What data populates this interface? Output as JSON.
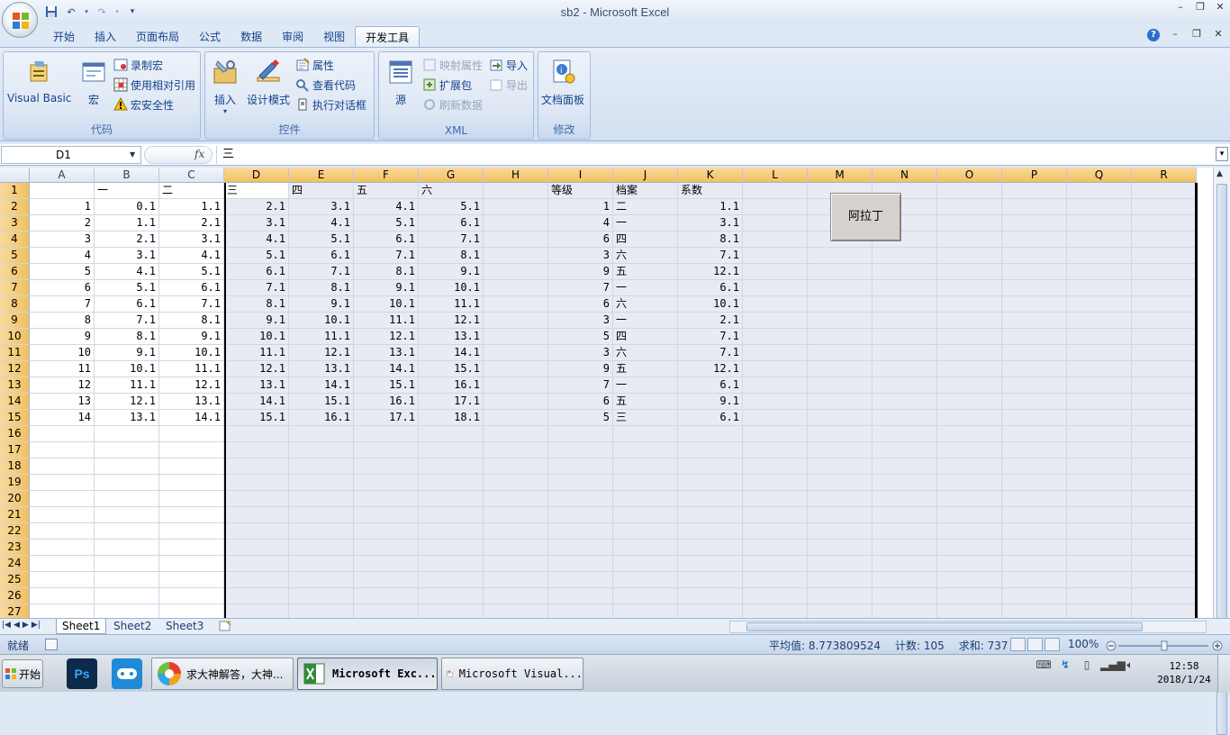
{
  "window": {
    "title": "sb2 - Microsoft Excel"
  },
  "tabs": [
    {
      "label": "开始"
    },
    {
      "label": "插入"
    },
    {
      "label": "页面布局"
    },
    {
      "label": "公式"
    },
    {
      "label": "数据"
    },
    {
      "label": "审阅"
    },
    {
      "label": "视图"
    },
    {
      "label": "开发工具",
      "active": true
    }
  ],
  "ribbon": {
    "code": {
      "label": "代码",
      "visual_basic": "Visual Basic",
      "macros": "宏",
      "record_macro": "录制宏",
      "relative_ref": "使用相对引用",
      "macro_security": "宏安全性"
    },
    "controls": {
      "label": "控件",
      "insert": "插入",
      "design_mode": "设计模式",
      "properties": "属性",
      "view_code": "查看代码",
      "run_dialog": "执行对话框"
    },
    "xml": {
      "label": "XML",
      "source": "源",
      "map_properties": "映射属性",
      "expansion_packs": "扩展包",
      "refresh_data": "刷新数据",
      "import": "导入",
      "export": "导出"
    },
    "modify": {
      "label": "修改",
      "doc_panel": "文档面板"
    }
  },
  "formula_bar": {
    "name_box": "D1",
    "formula": "三",
    "fx": "fx"
  },
  "columns": [
    "A",
    "B",
    "C",
    "D",
    "E",
    "F",
    "G",
    "H",
    "I",
    "J",
    "K",
    "L",
    "M",
    "N",
    "O",
    "P",
    "Q",
    "R"
  ],
  "rows": [
    {
      "n": "1",
      "c": [
        "",
        "一",
        "二",
        "三",
        "四",
        "五",
        "六",
        "",
        "等级",
        "档案",
        "系数",
        "",
        "",
        "",
        "",
        "",
        "",
        ""
      ]
    },
    {
      "n": "2",
      "c": [
        "1",
        "0.1",
        "1.1",
        "2.1",
        "3.1",
        "4.1",
        "5.1",
        "",
        "1",
        "二",
        "1.1",
        "",
        "",
        "",
        "",
        "",
        "",
        ""
      ]
    },
    {
      "n": "3",
      "c": [
        "2",
        "1.1",
        "2.1",
        "3.1",
        "4.1",
        "5.1",
        "6.1",
        "",
        "4",
        "一",
        "3.1",
        "",
        "",
        "",
        "",
        "",
        "",
        ""
      ]
    },
    {
      "n": "4",
      "c": [
        "3",
        "2.1",
        "3.1",
        "4.1",
        "5.1",
        "6.1",
        "7.1",
        "",
        "6",
        "四",
        "8.1",
        "",
        "",
        "",
        "",
        "",
        "",
        ""
      ]
    },
    {
      "n": "5",
      "c": [
        "4",
        "3.1",
        "4.1",
        "5.1",
        "6.1",
        "7.1",
        "8.1",
        "",
        "3",
        "六",
        "7.1",
        "",
        "",
        "",
        "",
        "",
        "",
        ""
      ]
    },
    {
      "n": "6",
      "c": [
        "5",
        "4.1",
        "5.1",
        "6.1",
        "7.1",
        "8.1",
        "9.1",
        "",
        "9",
        "五",
        "12.1",
        "",
        "",
        "",
        "",
        "",
        "",
        ""
      ]
    },
    {
      "n": "7",
      "c": [
        "6",
        "5.1",
        "6.1",
        "7.1",
        "8.1",
        "9.1",
        "10.1",
        "",
        "7",
        "一",
        "6.1",
        "",
        "",
        "",
        "",
        "",
        "",
        ""
      ]
    },
    {
      "n": "8",
      "c": [
        "7",
        "6.1",
        "7.1",
        "8.1",
        "9.1",
        "10.1",
        "11.1",
        "",
        "6",
        "六",
        "10.1",
        "",
        "",
        "",
        "",
        "",
        "",
        ""
      ]
    },
    {
      "n": "9",
      "c": [
        "8",
        "7.1",
        "8.1",
        "9.1",
        "10.1",
        "11.1",
        "12.1",
        "",
        "3",
        "一",
        "2.1",
        "",
        "",
        "",
        "",
        "",
        "",
        ""
      ]
    },
    {
      "n": "10",
      "c": [
        "9",
        "8.1",
        "9.1",
        "10.1",
        "11.1",
        "12.1",
        "13.1",
        "",
        "5",
        "四",
        "7.1",
        "",
        "",
        "",
        "",
        "",
        "",
        ""
      ]
    },
    {
      "n": "11",
      "c": [
        "10",
        "9.1",
        "10.1",
        "11.1",
        "12.1",
        "13.1",
        "14.1",
        "",
        "3",
        "六",
        "7.1",
        "",
        "",
        "",
        "",
        "",
        "",
        ""
      ]
    },
    {
      "n": "12",
      "c": [
        "11",
        "10.1",
        "11.1",
        "12.1",
        "13.1",
        "14.1",
        "15.1",
        "",
        "9",
        "五",
        "12.1",
        "",
        "",
        "",
        "",
        "",
        "",
        ""
      ]
    },
    {
      "n": "13",
      "c": [
        "12",
        "11.1",
        "12.1",
        "13.1",
        "14.1",
        "15.1",
        "16.1",
        "",
        "7",
        "一",
        "6.1",
        "",
        "",
        "",
        "",
        "",
        "",
        ""
      ]
    },
    {
      "n": "14",
      "c": [
        "13",
        "12.1",
        "13.1",
        "14.1",
        "15.1",
        "16.1",
        "17.1",
        "",
        "6",
        "五",
        "9.1",
        "",
        "",
        "",
        "",
        "",
        "",
        ""
      ]
    },
    {
      "n": "15",
      "c": [
        "14",
        "13.1",
        "14.1",
        "15.1",
        "16.1",
        "17.1",
        "18.1",
        "",
        "5",
        "三",
        "6.1",
        "",
        "",
        "",
        "",
        "",
        "",
        ""
      ]
    },
    {
      "n": "16",
      "c": []
    },
    {
      "n": "17",
      "c": []
    },
    {
      "n": "18",
      "c": []
    },
    {
      "n": "19",
      "c": []
    },
    {
      "n": "20",
      "c": []
    },
    {
      "n": "21",
      "c": []
    },
    {
      "n": "22",
      "c": []
    },
    {
      "n": "23",
      "c": []
    },
    {
      "n": "24",
      "c": []
    },
    {
      "n": "25",
      "c": []
    },
    {
      "n": "26",
      "c": []
    },
    {
      "n": "27",
      "c": []
    }
  ],
  "button_control": {
    "label": "阿拉丁"
  },
  "sheets": [
    {
      "label": "Sheet1",
      "active": true
    },
    {
      "label": "Sheet2"
    },
    {
      "label": "Sheet3"
    }
  ],
  "status": {
    "ready": "就绪",
    "average": "平均值: 8.773809524",
    "count": "计数: 105",
    "sum": "求和: 737",
    "zoom": "100%"
  },
  "taskbar": {
    "start": "开始",
    "tasks": [
      {
        "label": "求大神解答，大神..."
      },
      {
        "label": "Microsoft Exc...",
        "active": true
      },
      {
        "label": "Microsoft Visual..."
      }
    ],
    "time": "12:58",
    "date": "2018/1/24"
  },
  "colors": {
    "accent": "#15428b",
    "selected_header": "#f1c15f",
    "ribbon_bg": "#dfe8f5"
  }
}
